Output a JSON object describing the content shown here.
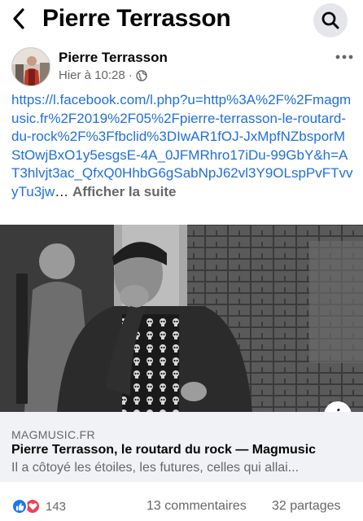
{
  "header": {
    "back_icon": "chevron-left-icon",
    "title": "Pierre Terrasson",
    "search_icon": "search-icon"
  },
  "post": {
    "author": "Pierre Terrasson",
    "timestamp": "Hier à 10:28",
    "separator": "·",
    "privacy_icon": "globe-icon",
    "more_icon": "more-horizontal-icon",
    "link_text": "https://l.facebook.com/l.php?u=http%3A%2F%2Fmagmusic.fr%2F2019%2F05%2Fpierre-terrasson-le-routard-du-rock%2F%3Ffbclid%3DIwAR1fOJ-JxMpfNZbsporMStOwjBxO1y5esgsE-4A_0JFMRhro17iDu-99GbY&h=AT3hlvjt3ac_QfxQ0HhbG6gSabNpJ62vl3Y9OLspPvFTvvyTu3jw",
    "ellipsis": "…",
    "see_more": "Afficher la suite"
  },
  "image": {
    "info_icon": "info-icon",
    "info_label": "i"
  },
  "link_preview": {
    "domain": "MAGMUSIC.FR",
    "title": "Pierre Terrasson, le routard du rock — Magmusic",
    "description": "Il a côtoyé les étoiles, les futures, celles qui allai..."
  },
  "footer": {
    "reaction_icons": [
      "like-icon",
      "love-icon"
    ],
    "reaction_count": "143",
    "comments": "13 commentaires",
    "shares": "32 partages"
  },
  "colors": {
    "link": "#216fdb",
    "like": "#1877f2",
    "love": "#f33e58",
    "secondary_text": "#65676b",
    "preview_bg": "#f0f2f5"
  }
}
